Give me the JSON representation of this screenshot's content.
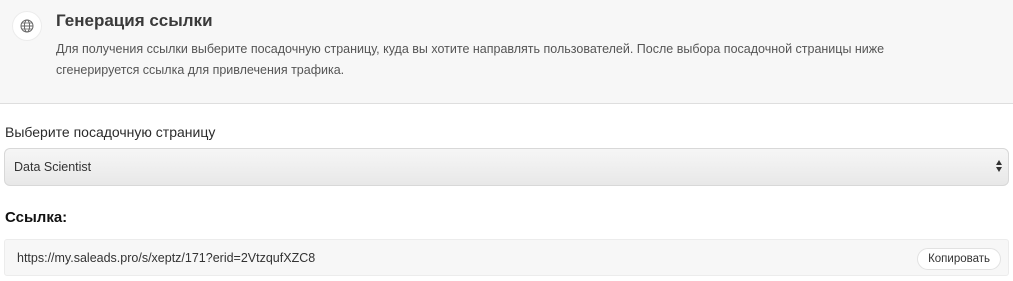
{
  "header": {
    "icon": "globe-icon",
    "title": "Генерация ссылки",
    "description_line1": "Для получения ссылки выберите посадочную страницу, куда вы хотите направлять пользователей. После выбора посадочной страницы ниже",
    "description_line2": "сгенерируется ссылка для привлечения трафика."
  },
  "landing": {
    "label": "Выберите посадочную страницу",
    "selected": "Data Scientist"
  },
  "link": {
    "label": "Ссылка:",
    "url": "https://my.saleads.pro/s/xeptz/171?erid=2VtzqufXZC8",
    "copy_label": "Копировать"
  }
}
